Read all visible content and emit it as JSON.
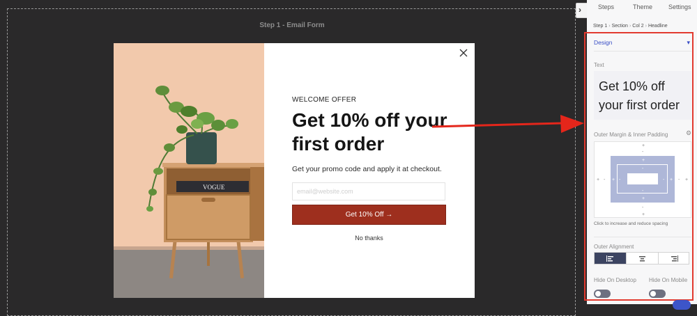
{
  "canvas": {
    "step_title": "Step 1 - Email Form"
  },
  "popup": {
    "eyebrow": "WELCOME OFFER",
    "headline": "Get 10% off your first order",
    "subtext": "Get your promo code and apply it at checkout.",
    "email_placeholder": "email@website.com",
    "cta_label": "Get 10% Off  →",
    "decline_label": "No thanks",
    "book_text": "VOGUE"
  },
  "panel": {
    "tabs": [
      "Steps",
      "Theme",
      "Settings"
    ],
    "breadcrumb": [
      "Step 1",
      "Section",
      "Col 2",
      "Headline"
    ],
    "design_label": "Design",
    "text_label": "Text",
    "text_value": "Get 10% off your first order",
    "margin_label": "Outer Margin & Inner Padding",
    "spacing_hint": "Click to increase and reduce spacing",
    "alignment_label": "Outer Alignment",
    "alignment_selected": "left",
    "hide_desktop_label": "Hide On Desktop",
    "hide_mobile_label": "Hide On Mobile",
    "hide_desktop": false,
    "hide_mobile": false
  },
  "colors": {
    "canvas_bg": "#2a292a",
    "cta_bg": "#9e2f1e",
    "accent": "#3a4fc6",
    "highlight": "#e23a2f"
  }
}
